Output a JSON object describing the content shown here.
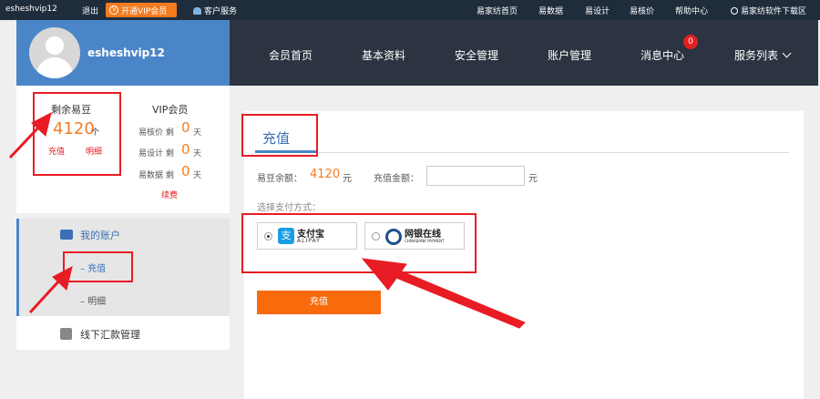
{
  "topbar": {
    "username": "esheshvip12",
    "logout": "退出",
    "vip_button": "开通VIP会员",
    "service": "客户服务",
    "links": [
      "易家纺首页",
      "易数据",
      "易设计",
      "易核价",
      "帮助中心"
    ],
    "download": "易家纺软件下载区"
  },
  "header": {
    "username": "esheshvip12",
    "nav": [
      "会员首页",
      "基本资料",
      "安全管理",
      "账户管理",
      "消息中心",
      "服务列表"
    ],
    "message_badge": "0"
  },
  "balance": {
    "title": "剩余易豆",
    "value": "4120",
    "unit": "个",
    "recharge": "充值",
    "detail": "明细"
  },
  "vip": {
    "title": "VIP会员",
    "rows": [
      {
        "label": "易核价 剩",
        "value": "0",
        "unit": "天"
      },
      {
        "label": "易设计 剩",
        "value": "0",
        "unit": "天"
      },
      {
        "label": "易数据 剩",
        "value": "0",
        "unit": "天"
      }
    ],
    "renew": "续费"
  },
  "sidebar": {
    "account": "我的账户",
    "sub_recharge": "– 充值",
    "sub_detail": "– 明细",
    "offline": "线下汇款管理"
  },
  "main": {
    "tab": "充值",
    "balance_label": "易豆余额：",
    "balance_value": "4120",
    "balance_unit": "元",
    "amount_label": "充值金额：",
    "amount_value": "",
    "amount_unit": "元",
    "pay_label": "选择支付方式：",
    "alipay_cn": "支付宝",
    "alipay_en": "ALIPAY",
    "chinabank_cn": "网银在线",
    "chinabank_en": "CHINABANK PAYMENT",
    "submit": "充值"
  },
  "colors": {
    "accent_blue": "#4a85c8",
    "orange": "#f76b0c",
    "highlight_red": "#e81c24"
  }
}
